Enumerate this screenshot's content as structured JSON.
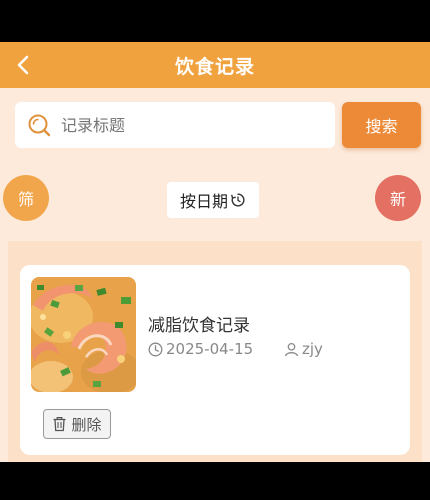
{
  "header": {
    "title": "饮食记录",
    "back_icon": "chevron-left-icon"
  },
  "search": {
    "placeholder": "记录标题",
    "button_label": "搜索",
    "icon": "search-icon"
  },
  "actions": {
    "filter_label": "筛",
    "new_label": "新",
    "date_sort_label": "按日期",
    "date_sort_icon": "clock-refresh-icon"
  },
  "records": [
    {
      "title": "减脂饮食记录",
      "date": "2025-04-15",
      "user": "zjy",
      "delete_label": "删除",
      "image": "shrimp-dish-photo"
    }
  ],
  "colors": {
    "header": "#f0a23f",
    "search_button": "#ec8a38",
    "filter_button": "#f2a64b",
    "new_button": "#e37062",
    "background": "#fdeadb"
  }
}
